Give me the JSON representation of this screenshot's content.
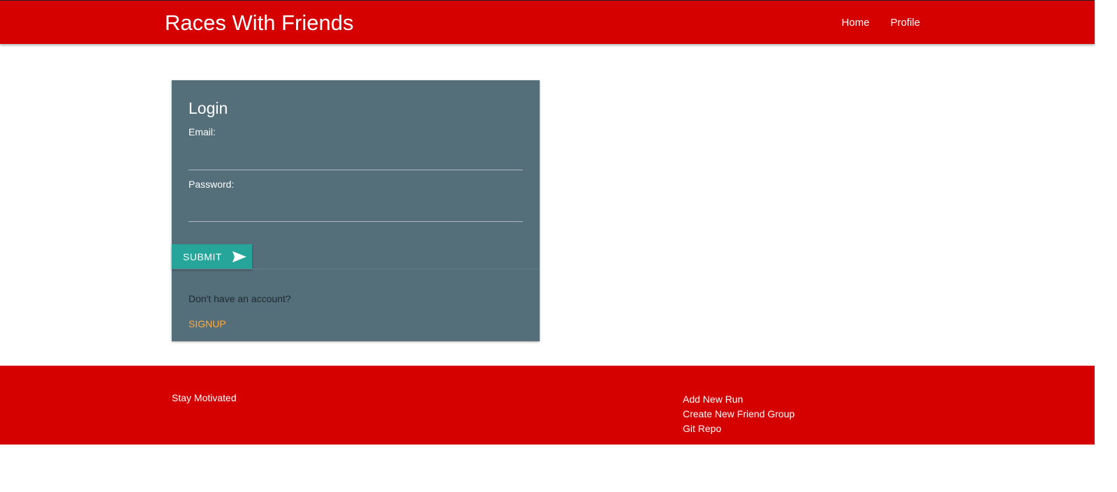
{
  "header": {
    "brand": "Races With Friends",
    "nav": [
      {
        "label": "Home"
      },
      {
        "label": "Profile"
      }
    ],
    "color": "#d50000"
  },
  "login": {
    "title": "Login",
    "email_label": "Email:",
    "email_value": "",
    "password_label": "Password:",
    "password_value": "",
    "submit_label": "SUBMIT",
    "submit_icon": "send-icon",
    "no_account_text": "Don't have an account?",
    "signup_label": "SIGNUP",
    "card_color": "#546e7a",
    "button_color": "#26a69a",
    "signup_color": "#ffab40"
  },
  "footer": {
    "motto": "Stay Motivated",
    "links": [
      {
        "label": "Add New Run"
      },
      {
        "label": "Create New Friend Group"
      },
      {
        "label": "Git Repo"
      }
    ]
  }
}
